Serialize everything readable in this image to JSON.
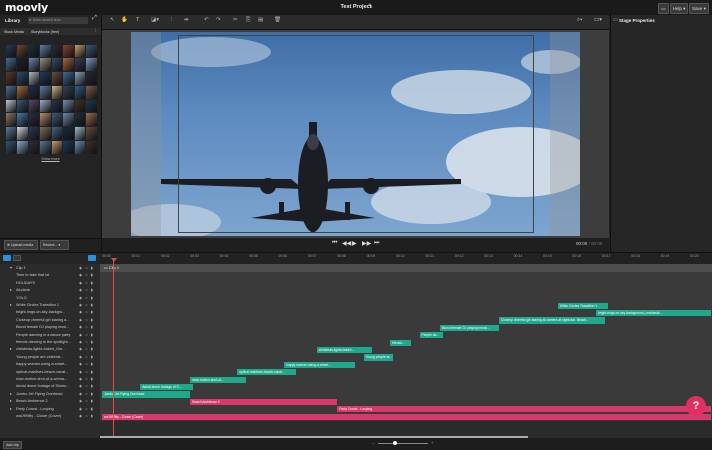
{
  "app": {
    "logo": "moovly",
    "project_title": "Test Project"
  },
  "topbar": {
    "help_label": "Help ▾",
    "save_label": "Save ▾"
  },
  "library": {
    "title": "Library",
    "search_placeholder": "Enter search term",
    "tab_stock": "Stock Media",
    "tab_storyblocks": "Storyblocks (free)",
    "show_more": "Show more",
    "upload_label": "Upload media",
    "recent_label": "Recent...",
    "thumb_colors": [
      "#243b5a",
      "#6a4a2a",
      "#1b2e46",
      "#5e7fa6",
      "#2d2d3b",
      "#884433",
      "#c8a070",
      "#3a5a78",
      "#4a6e8c",
      "#1f1f2f",
      "#6688aa",
      "#9a8f7e",
      "#2f4f6f",
      "#aa6644",
      "#3b3b5b",
      "#7a9cc6",
      "#5a3a2a",
      "#2a4a6a",
      "#b0b8c0",
      "#1e3a5a",
      "#6d4c3a",
      "#3c6a9a",
      "#8fa5b8",
      "#272737",
      "#4d6d8d",
      "#a36b3f",
      "#1d2d4d",
      "#5d7d9d",
      "#cdb08a",
      "#334455",
      "#2f5f8f",
      "#7b5b4b",
      "#c0c8d0",
      "#385878",
      "#5a4a6a",
      "#9ab0c8",
      "#263646",
      "#6e8eae",
      "#453525",
      "#1a3a5a",
      "#8a7a6a",
      "#4a7aaa",
      "#2c2c4c",
      "#b59070",
      "#3d5d7d",
      "#6a8aaa",
      "#1f2f3f",
      "#9c6c4c",
      "#5b7b9b",
      "#d0d8e0",
      "#2a3a5a",
      "#7e6e5e",
      "#446688",
      "#1b2b3b",
      "#a0b8d0",
      "#6b4b3b",
      "#355575",
      "#8db0cf",
      "#2e2e3e",
      "#587898",
      "#c49a6c",
      "#1c3c5c",
      "#7090b0",
      "#3f2f2f"
    ]
  },
  "canvas": {
    "time_current": "00:00",
    "time_total": "00:00"
  },
  "properties": {
    "title": "Stage Properties"
  },
  "timeline": {
    "ticks": [
      "00:00",
      "00:01",
      "00:02",
      "00:03",
      "00:04",
      "00:05",
      "00:06",
      "00:07",
      "00:08",
      "00:09",
      "00:10",
      "00:11",
      "00:12",
      "00:13",
      "00:14",
      "00:15",
      "00:16",
      "00:17",
      "00:18",
      "00:19",
      "00:20"
    ],
    "clip_label": "Clip 1",
    "layers": [
      {
        "label": "Clip 1",
        "chev": "▾"
      },
      {
        "label": "Time to take that lot",
        "chev": ""
      },
      {
        "label": "HOLIDAYS",
        "chev": ""
      },
      {
        "label": "Airplane",
        "chev": "▸"
      },
      {
        "label": "YOLO",
        "chev": ""
      },
      {
        "label": "White Circles Transition 1",
        "chev": "▸"
      },
      {
        "label": "bright-rings-on-sky-backgro...",
        "chev": ""
      },
      {
        "label": "Closeup cheerful girl staring a...",
        "chev": ""
      },
      {
        "label": "Blond female DJ playing musi...",
        "chev": ""
      },
      {
        "label": "People dancing in a dance party",
        "chev": ""
      },
      {
        "label": "friends dancing to the spotlight...",
        "chev": ""
      },
      {
        "label": "christmas-lights-bokeh_Gm...",
        "chev": "▸"
      },
      {
        "label": "Young people are celebrat...",
        "chev": ""
      },
      {
        "label": "happy-woman-using-a-smart...",
        "chev": ""
      },
      {
        "label": "optical-maldives-beach-vacat...",
        "chev": ""
      },
      {
        "label": "slow-motion-shot-of-a-woma...",
        "chev": ""
      },
      {
        "label": "Aerial drone footage of Shimo...",
        "chev": ""
      },
      {
        "label": "Jumbo Jet Flying Overhead",
        "chev": "▸"
      },
      {
        "label": "Beach Ambience 2",
        "chev": "▸"
      },
      {
        "label": "Party Crowd - Looping",
        "chev": "▸"
      },
      {
        "label": "wa1999fly - Closer (Cover)",
        "chev": ""
      }
    ],
    "bars": [
      {
        "row": 5,
        "start": 15.5,
        "end": 17.2,
        "label": "White Circles Transition 1",
        "color": "teal"
      },
      {
        "row": 6,
        "start": 16.8,
        "end": 20.8,
        "label": "bright-rings-on-sky-background_ccwkbwtk...",
        "color": "teal"
      },
      {
        "row": 7,
        "start": 13.5,
        "end": 17.1,
        "label": "Closeup cheerful girl staring at camera at nightclub. Beach...",
        "color": "teal"
      },
      {
        "row": 8,
        "start": 11.5,
        "end": 13.5,
        "label": "Blond female DJ playing music...",
        "color": "teal"
      },
      {
        "row": 9,
        "start": 10.8,
        "end": 11.6,
        "label": "People da...",
        "color": "teal"
      },
      {
        "row": 10,
        "start": 9.8,
        "end": 10.5,
        "label": "friends...",
        "color": "teal"
      },
      {
        "row": 11,
        "start": 7.3,
        "end": 9.2,
        "label": "christmas-lights-bokeh...",
        "color": "teal"
      },
      {
        "row": 12,
        "start": 8.9,
        "end": 9.9,
        "label": "Young people ar...",
        "color": "teal"
      },
      {
        "row": 13,
        "start": 6.2,
        "end": 8.6,
        "label": "happy-woman-using-a-smart...",
        "color": "teal"
      },
      {
        "row": 14,
        "start": 4.6,
        "end": 6.6,
        "label": "optical-maldives-beach-vacat...",
        "color": "teal"
      },
      {
        "row": 15,
        "start": 3.0,
        "end": 4.9,
        "label": "slow-motion-shot-of-...",
        "color": "teal"
      },
      {
        "row": 16,
        "start": 1.3,
        "end": 3.1,
        "label": "Aerial drone footage of S...",
        "color": "teal"
      },
      {
        "row": 17,
        "start": 0.0,
        "end": 3.0,
        "label": "Jumbo Jet Flying Overhead",
        "color": "teal"
      },
      {
        "row": 18,
        "start": 3.0,
        "end": 8.0,
        "label": "Beach Ambience 2",
        "color": "pink"
      },
      {
        "row": 19,
        "start": 8.0,
        "end": 20.8,
        "label": "Party Crowd - Looping",
        "color": "pink"
      },
      {
        "row": 20,
        "start": 0.0,
        "end": 20.8,
        "label": "wa1999fly - Closer (Cover)",
        "color": "pink"
      }
    ],
    "add_clip_label": "Add clip",
    "help_fab": "?"
  }
}
